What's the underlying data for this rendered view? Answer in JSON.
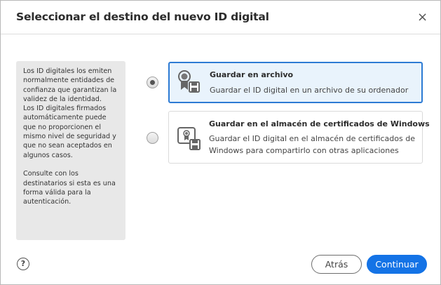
{
  "dialog": {
    "title": "Seleccionar el destino del nuevo ID digital",
    "close_icon": "×"
  },
  "info": {
    "lines": [
      "Los ID digitales los emiten",
      "normalmente entidades de",
      "confianza que garantizan la",
      "validez de la identidad.",
      "Los ID digitales firmados",
      "automáticamente puede",
      "que no proporcionen el",
      "mismo nivel de seguridad y",
      "que no sean aceptados en",
      "algunos casos.",
      "",
      "Consulte con los",
      "destinatarios si esta es una",
      "forma válida para la",
      "autenticación."
    ]
  },
  "options": [
    {
      "title": "Guardar en archivo",
      "desc1": "Guardar el ID digital en un archivo de su ordenador",
      "selected": true
    },
    {
      "title": "Guardar en el almacén de certificados de Windows",
      "desc1": "Guardar el ID digital en el almacén de certificados de",
      "desc2": "Windows para compartirlo con otras aplicaciones",
      "selected": false
    }
  ],
  "footer": {
    "help": "?",
    "back": "Atrás",
    "continue": "Continuar"
  },
  "colors": {
    "accent": "#1473e6",
    "selected_border": "#2d7bd4",
    "selected_bg": "#e9f3fc"
  }
}
